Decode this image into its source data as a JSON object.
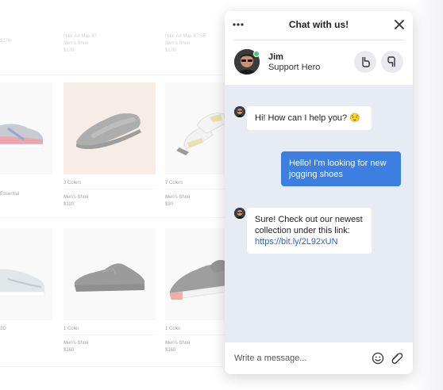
{
  "shop": {
    "ghost_row": [
      {
        "line1": "Nike Air Max 97",
        "line2": "Men's Shoe",
        "price": "$170"
      },
      {
        "line1": "Nike Air Max 97 SE",
        "line2": "Men's Shoe",
        "price": "$170"
      },
      {
        "line1": "Nike Air Max 97 SE",
        "line2": "Men's Shoe",
        "price": "$170"
      },
      {
        "line1": "",
        "line2": "",
        "price": "$170"
      }
    ],
    "row1": [
      {
        "colors": "",
        "name": "Essential",
        "price": ""
      },
      {
        "colors": "3 Colors",
        "name": "Men's Shoe",
        "price": "$110"
      },
      {
        "colors": "7 Colors",
        "name": "Men's Shoe",
        "price": "$90"
      }
    ],
    "row2": [
      {
        "colors": "3D",
        "name": "",
        "price": ""
      },
      {
        "colors": "1 Color",
        "name": "Men's Shoe",
        "price": "$160"
      },
      {
        "colors": "1 Color",
        "name": "Men's Shoe",
        "price": "$160"
      }
    ]
  },
  "chat": {
    "title": "Chat with us!",
    "agent": {
      "name": "Jim",
      "role": "Support Hero",
      "status": "online"
    },
    "messages": [
      {
        "from": "agent",
        "text": "Hi! How can I help you? 😌"
      },
      {
        "from": "user",
        "text": "Hello! I'm looking for new jogging shoes"
      },
      {
        "from": "agent",
        "text": "Sure! Check out our newest collection under this link:",
        "link": "https://bit.ly/2L92xUN"
      }
    ],
    "composer": {
      "placeholder": "Write a message..."
    }
  },
  "colors": {
    "accent": "#3c7fe0",
    "chat_bg": "#e6ebf4",
    "online": "#3fcf6d",
    "link": "#2b63c6"
  },
  "icons": [
    "more-icon",
    "close-icon",
    "thumbs-up-icon",
    "thumbs-down-icon",
    "emoji-icon",
    "attach-icon"
  ]
}
